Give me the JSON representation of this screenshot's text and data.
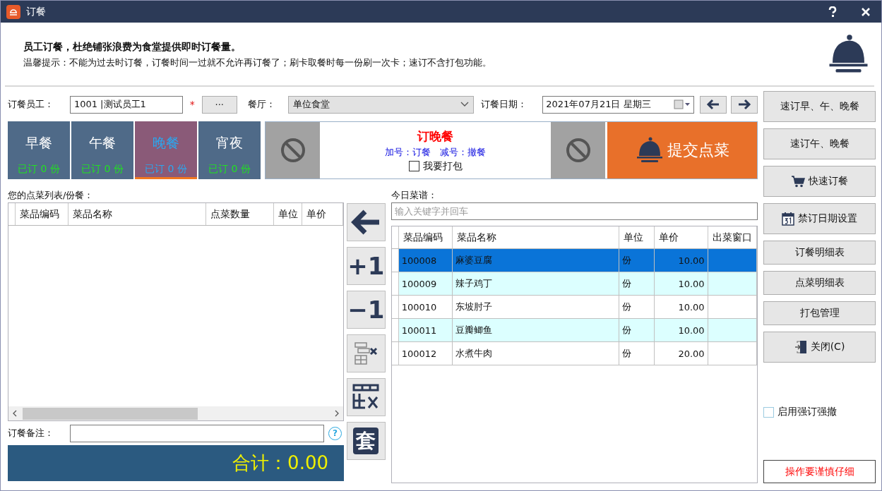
{
  "window": {
    "title": "订餐"
  },
  "header": {
    "headline": "员工订餐，杜绝铺张浪费为食堂提供即时订餐量。",
    "tip": "温馨提示：不能为过去时订餐，订餐时间一过就不允许再订餐了；刷卡取餐时每一份刷一次卡；速订不含打包功能。"
  },
  "form": {
    "employee_label": "订餐员工：",
    "employee_value": "1001 |测试员工1",
    "required_mark": "*",
    "browse_button": "···",
    "canteen_label": "餐厅：",
    "canteen_value": "单位食堂",
    "date_label": "订餐日期：",
    "date_value": "2021年07月21日  星期三"
  },
  "meals": [
    {
      "name": "早餐",
      "count": "已订 0 份",
      "selected": false
    },
    {
      "name": "午餐",
      "count": "已订 0 份",
      "selected": false
    },
    {
      "name": "晚餐",
      "count": "已订 0 份",
      "selected": true
    },
    {
      "name": "宵夜",
      "count": "已订 0 份",
      "selected": false
    }
  ],
  "order": {
    "title": "订晚餐",
    "hint": "加号：订餐   减号：撤餐",
    "pack": {
      "label": "我要打包",
      "checked": false
    },
    "submit": "提交点菜"
  },
  "my_list": {
    "label": "您的点菜列表/份餐：",
    "columns": [
      "菜品编码",
      "菜品名称",
      "点菜数量",
      "单位",
      "单价"
    ]
  },
  "remarks": {
    "label": "订餐备注：",
    "help": "?"
  },
  "total": "合计：0.00",
  "tools": [
    {
      "kind": "back"
    },
    {
      "kind": "text",
      "text": "+1"
    },
    {
      "kind": "text",
      "text": "−1"
    },
    {
      "kind": "remove-row"
    },
    {
      "kind": "clear-table"
    },
    {
      "kind": "set",
      "text": "套"
    }
  ],
  "menu": {
    "label": "今日菜谱：",
    "search_placeholder": "输入关键字并回车",
    "columns": [
      "菜品编码",
      "菜品名称",
      "单位",
      "单价",
      "出菜窗口"
    ],
    "rows": [
      {
        "code": "100008",
        "name": "麻婆豆腐",
        "unit": "份",
        "price": "10.00",
        "selected": true
      },
      {
        "code": "100009",
        "name": "辣子鸡丁",
        "unit": "份",
        "price": "10.00",
        "selected": false
      },
      {
        "code": "100010",
        "name": "东坡肘子",
        "unit": "份",
        "price": "10.00",
        "selected": false
      },
      {
        "code": "100011",
        "name": "豆瓣鲫鱼",
        "unit": "份",
        "price": "10.00",
        "selected": false
      },
      {
        "code": "100012",
        "name": "水煮牛肉",
        "unit": "份",
        "price": "20.00",
        "selected": false
      }
    ]
  },
  "actions": [
    {
      "kind": "tall",
      "label": "速订早、午、晚餐"
    },
    {
      "kind": "tall",
      "label": "速订午、晚餐"
    },
    {
      "kind": "cart",
      "label": "快速订餐"
    },
    {
      "kind": "calendar",
      "label": "禁订日期设置"
    },
    {
      "kind": "short",
      "label": "订餐明细表"
    },
    {
      "kind": "short",
      "label": "点菜明细表"
    },
    {
      "kind": "short",
      "label": "打包管理"
    },
    {
      "kind": "door",
      "label": "关闭(C)"
    }
  ],
  "force_option": {
    "label": "启用强订强撤",
    "checked": false
  },
  "warning": "操作要谨慎仔细"
}
